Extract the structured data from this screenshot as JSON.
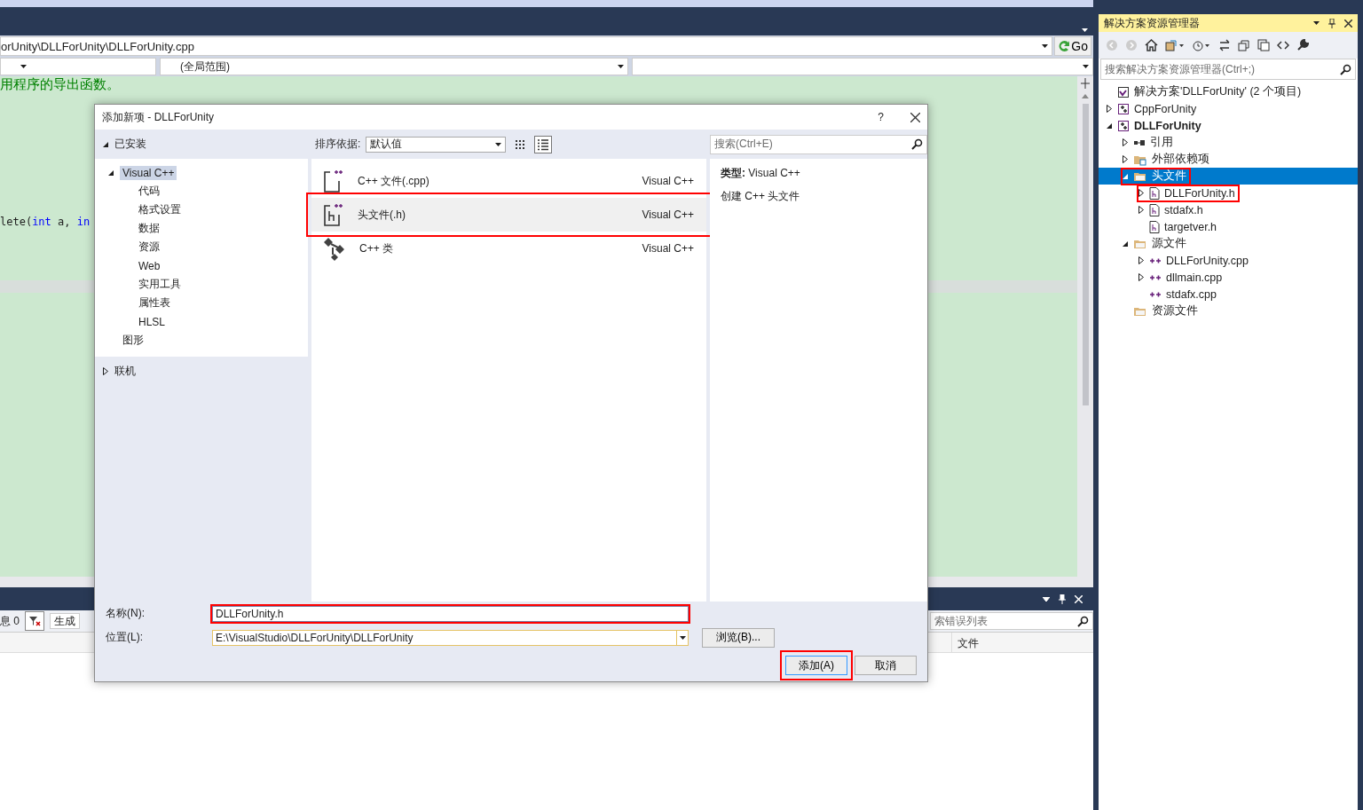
{
  "editor": {
    "path": "orUnity\\DLLForUnity\\DLLForUnity.cpp",
    "go": "Go",
    "scope": "(全局范围)",
    "code": [
      [
        {
          "text": "用程序的导出函数。",
          "kind": "comment"
        }
      ],
      [
        {
          "text": "lete(",
          "kind": "plain"
        },
        {
          "text": "int",
          "kind": "keyword"
        },
        {
          "text": " a, ",
          "kind": "plain"
        },
        {
          "text": "in",
          "kind": "keyword"
        }
      ]
    ]
  },
  "error_list": {
    "messages": "息 0",
    "build_filter": "生成",
    "search": {
      "placeholder": "索错误列表"
    },
    "columns": [
      "文件"
    ]
  },
  "solution_explorer": {
    "title": "解决方案资源管理器",
    "search": {
      "placeholder": "搜索解决方案资源管理器(Ctrl+;)"
    },
    "tree": [
      {
        "label": "解决方案'DLLForUnity' (2 个项目)",
        "kind": "solution",
        "selected": false,
        "highlighted": false,
        "children": [
          {
            "label": "CppForUnity",
            "kind": "project",
            "expanded": false,
            "startup": false,
            "selected": false,
            "highlighted": false
          },
          {
            "label": "DLLForUnity",
            "kind": "project",
            "expanded": true,
            "startup": true,
            "selected": false,
            "highlighted": false,
            "children": [
              {
                "label": "引用",
                "kind": "references",
                "expanded": false,
                "selected": false,
                "highlighted": false
              },
              {
                "label": "外部依赖项",
                "kind": "external",
                "expanded": false,
                "selected": false,
                "highlighted": false
              },
              {
                "label": "头文件",
                "kind": "folder",
                "expanded": true,
                "selected": true,
                "highlighted": true,
                "children": [
                  {
                    "label": "DLLForUnity.h",
                    "kind": "header",
                    "expanded": false,
                    "selected": false,
                    "highlighted": true
                  },
                  {
                    "label": "stdafx.h",
                    "kind": "header",
                    "expanded": false,
                    "selected": false,
                    "highlighted": false
                  },
                  {
                    "label": "targetver.h",
                    "kind": "header",
                    "selected": false,
                    "highlighted": false
                  }
                ]
              },
              {
                "label": "源文件",
                "kind": "folder",
                "expanded": true,
                "selected": false,
                "highlighted": false,
                "children": [
                  {
                    "label": "DLLForUnity.cpp",
                    "kind": "source",
                    "expanded": false,
                    "selected": false,
                    "highlighted": false
                  },
                  {
                    "label": "dllmain.cpp",
                    "kind": "source",
                    "expanded": false,
                    "selected": false,
                    "highlighted": false
                  },
                  {
                    "label": "stdafx.cpp",
                    "kind": "source",
                    "selected": false,
                    "highlighted": false
                  }
                ]
              },
              {
                "label": "资源文件",
                "kind": "folder",
                "selected": false,
                "highlighted": false
              }
            ]
          }
        ]
      }
    ]
  },
  "dialog": {
    "title": "添加新项 - DLLForUnity",
    "help": "?",
    "installed": {
      "label": "已安装",
      "expanded": true,
      "categories": [
        {
          "label": "Visual C++",
          "expanded": true,
          "selected": true,
          "children": [
            {
              "label": "代码",
              "selected": false
            },
            {
              "label": "格式设置",
              "selected": false
            },
            {
              "label": "数据",
              "selected": false
            },
            {
              "label": "资源",
              "selected": false
            },
            {
              "label": "Web",
              "selected": false
            },
            {
              "label": "实用工具",
              "selected": false
            },
            {
              "label": "属性表",
              "selected": false
            },
            {
              "label": "HLSL",
              "selected": false
            }
          ]
        },
        {
          "label": "图形",
          "selected": false
        }
      ]
    },
    "online": {
      "label": "联机",
      "expanded": false
    },
    "sort_label": "排序依据:",
    "sort_value": "默认值",
    "search": {
      "placeholder": "搜索(Ctrl+E)"
    },
    "templates": [
      {
        "name": "C++ 文件(.cpp)",
        "language": "Visual C++",
        "kind": "cpp",
        "selected": false,
        "highlighted": false
      },
      {
        "name": "头文件(.h)",
        "language": "Visual C++",
        "kind": "header",
        "selected": true,
        "highlighted": true
      },
      {
        "name": "C++ 类",
        "language": "Visual C++",
        "kind": "class",
        "selected": false,
        "highlighted": false
      }
    ],
    "details": [
      "**类型:**  Visual C++",
      "创建 C++ 头文件"
    ],
    "name_label": "名称(N):",
    "name_value": "DLLForUnity.h",
    "name_highlighted": true,
    "location_label": "位置(L):",
    "location_value": "E:\\VisualStudio\\DLLForUnity\\DLLForUnity",
    "browse": "浏览(B)...",
    "add": {
      "label": "添加(A)",
      "highlighted": true
    },
    "cancel": "取消"
  }
}
